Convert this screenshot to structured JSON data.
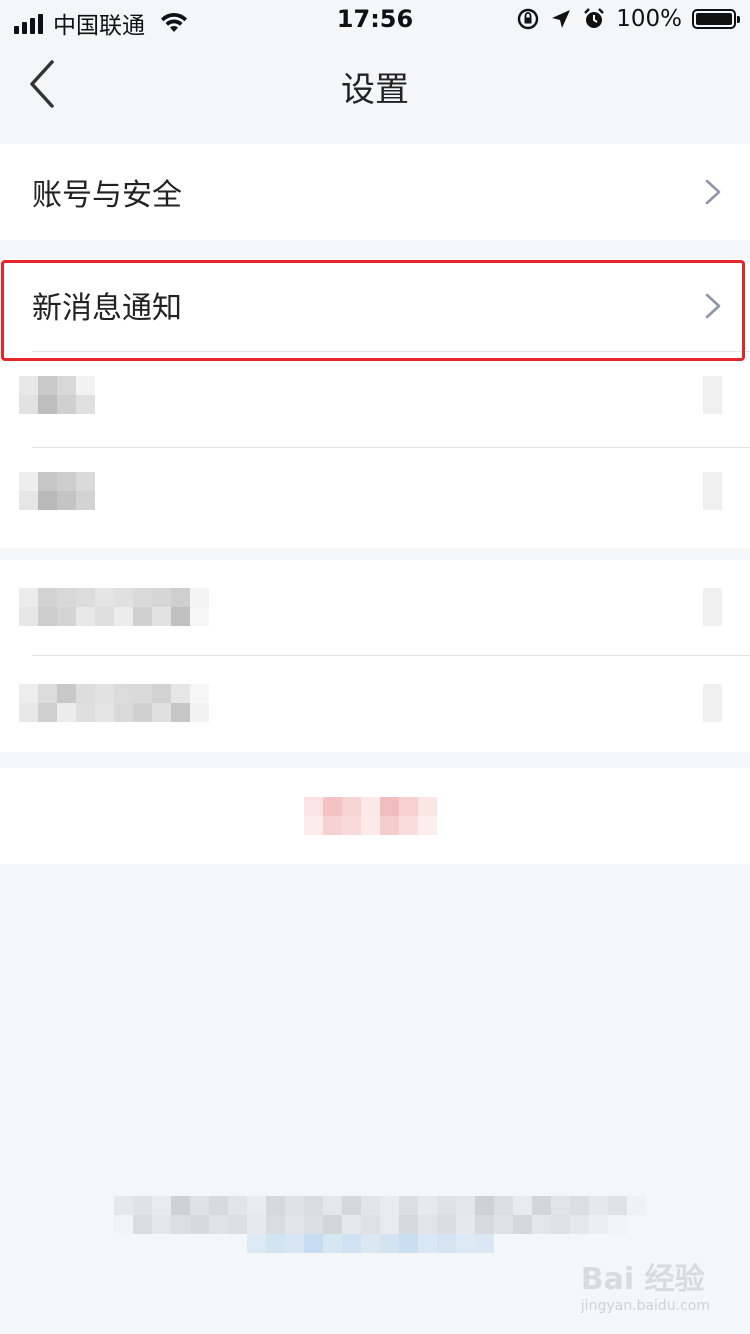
{
  "status_bar": {
    "carrier": "中国联通",
    "time": "17:56",
    "battery": "100%"
  },
  "nav": {
    "title": "设置"
  },
  "rows": {
    "account_security": "账号与安全",
    "new_message_notify": "新消息通知"
  },
  "watermark": {
    "brand": "Bai  经验",
    "url": "jingyan.baidu.com"
  },
  "colors": {
    "background": "#f5f6f8",
    "highlight": "#e5262b",
    "chevron": "#8e96a8"
  }
}
